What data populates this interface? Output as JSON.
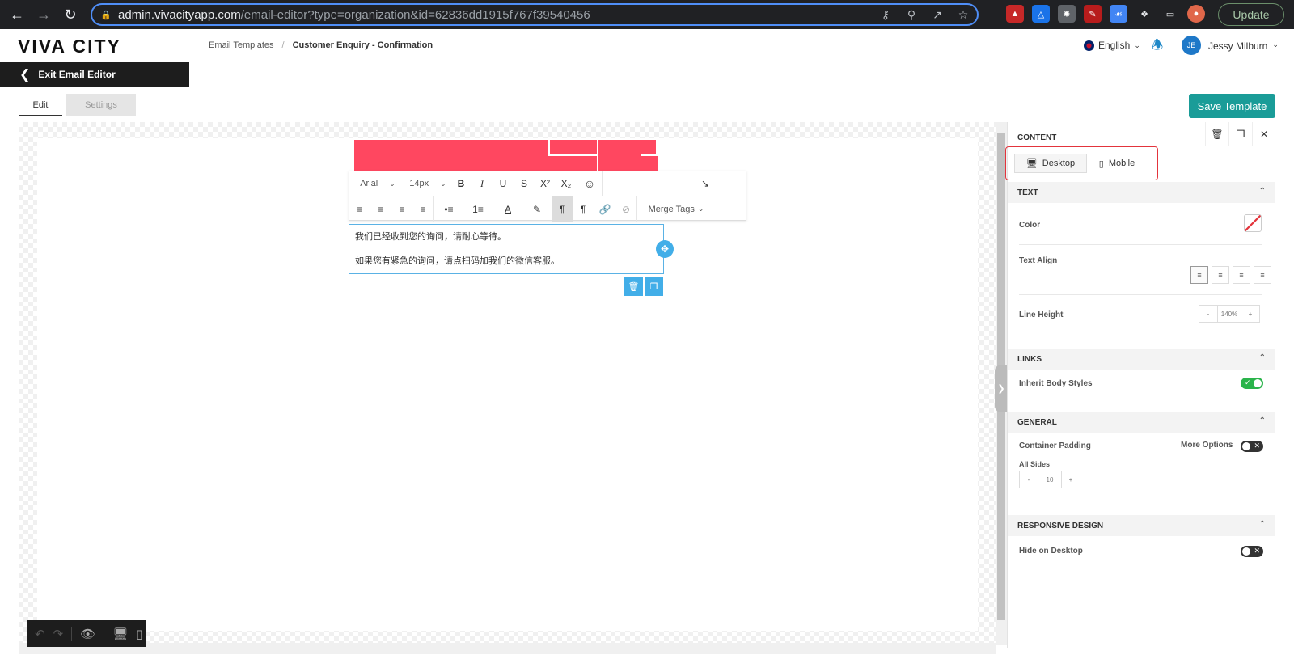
{
  "browser": {
    "url_host": "admin.vivacityapp.com",
    "url_rest": "/email-editor?type=organization&id=62836dd1915f767f39540456",
    "update_label": "Update"
  },
  "header": {
    "logo": "VIVA CITY",
    "breadcrumb": [
      "Email Templates",
      "/",
      "Customer Enquiry - Confirmation"
    ],
    "language": "English",
    "user_initials": "JE",
    "user_name": "Jessy Milburn"
  },
  "editor": {
    "exit_label": "Exit Email Editor",
    "tabs": [
      "Edit",
      "Settings"
    ],
    "save_label": "Save Template"
  },
  "toolbar": {
    "font": "Arial",
    "size": "14px",
    "merge_tags": "Merge Tags"
  },
  "content": {
    "line1": "我们已经收到您的询问，请耐心等待。",
    "line2": "如果您有紧急的询问，请点扫码加我们的微信客服。"
  },
  "panel": {
    "title": "CONTENT",
    "device": [
      "Desktop",
      "Mobile"
    ],
    "sections": {
      "text": "TEXT",
      "links": "LINKS",
      "general": "GENERAL",
      "responsive": "RESPONSIVE DESIGN"
    },
    "labels": {
      "color": "Color",
      "text_align": "Text Align",
      "line_height": "Line Height",
      "inherit": "Inherit Body Styles",
      "container_padding": "Container Padding",
      "more_options": "More Options",
      "all_sides": "All Sides",
      "hide_desktop": "Hide on Desktop"
    },
    "line_height_value": "140%",
    "padding_value": "10",
    "stepper_minus": "-",
    "stepper_plus": "+",
    "inherit_body_styles": true,
    "more_options": false,
    "hide_on_desktop": false
  }
}
